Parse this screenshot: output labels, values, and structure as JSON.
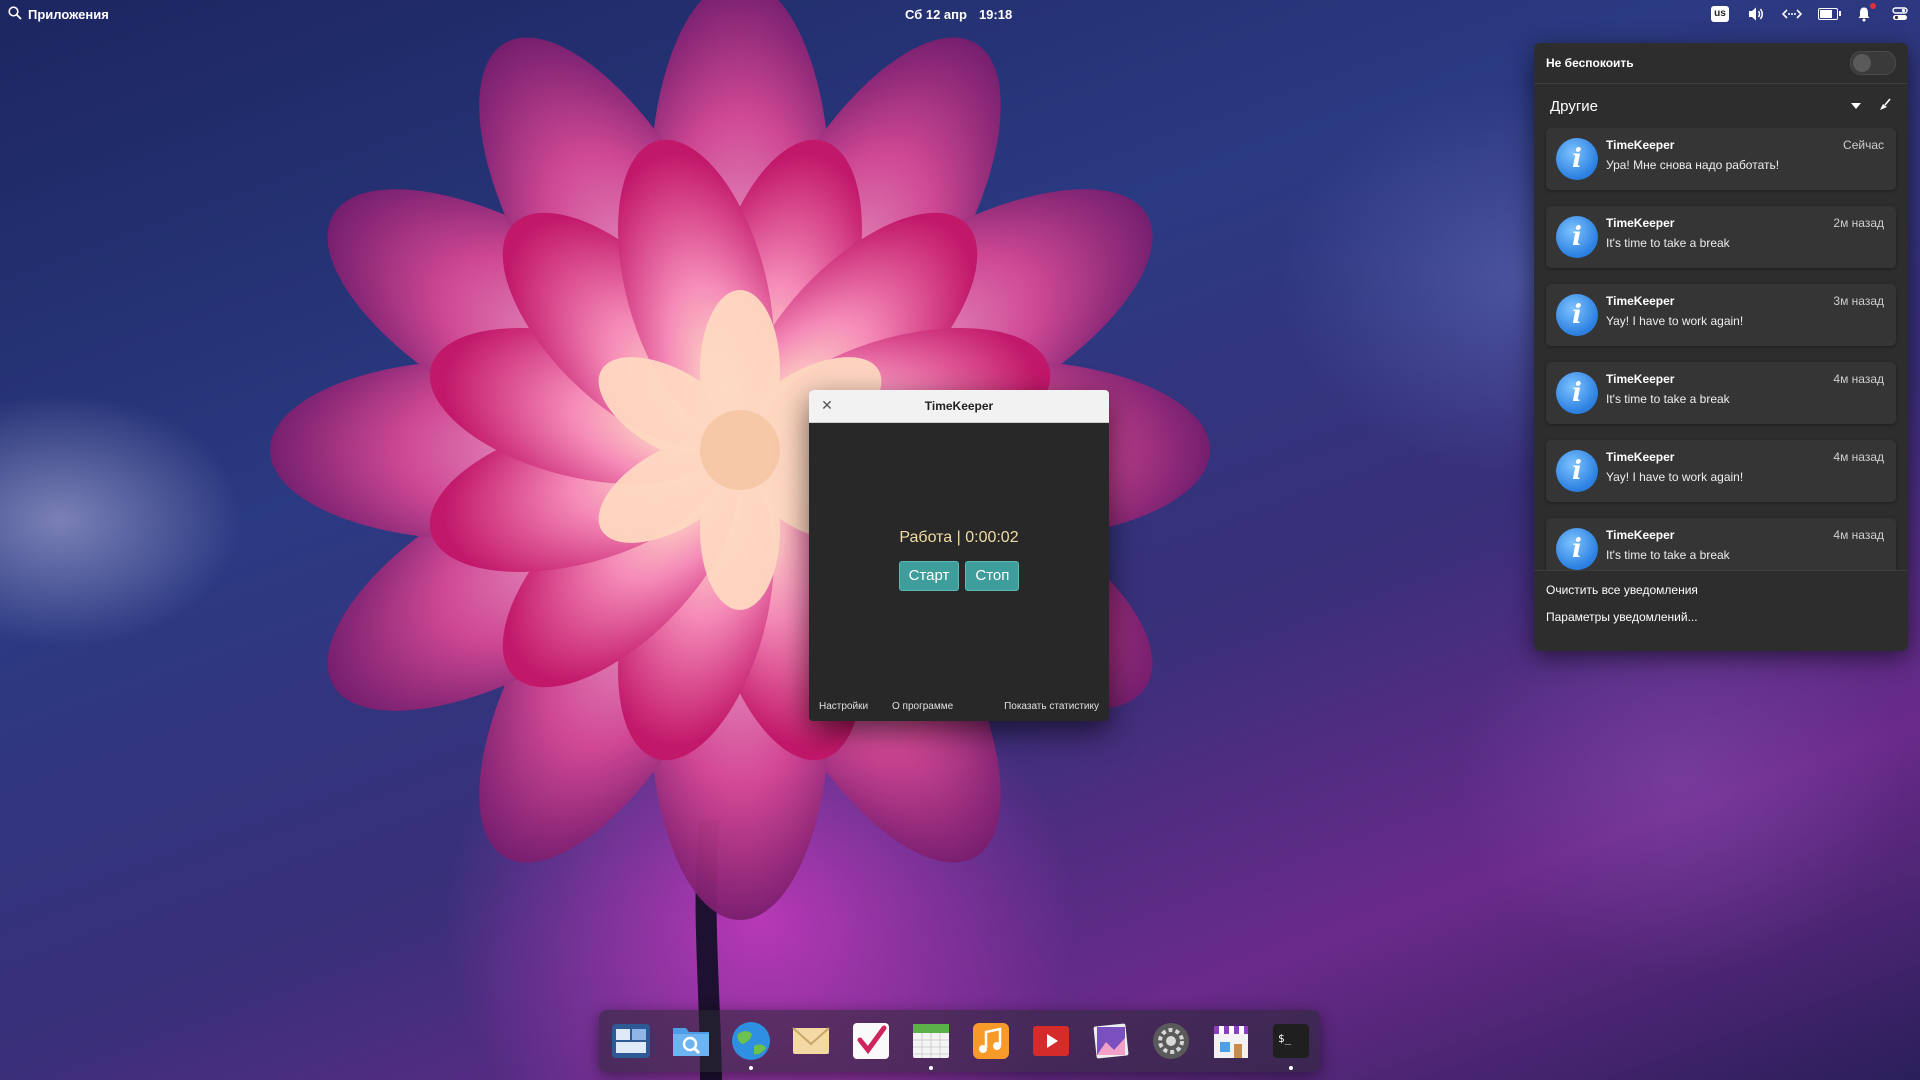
{
  "top_panel": {
    "applications_label": "Приложения",
    "date": "Сб 12 апр",
    "time": "19:18",
    "keyboard_layout": "us",
    "battery_level_percent": 70
  },
  "notification_panel": {
    "dnd_label": "Не беспокоить",
    "dnd_enabled": false,
    "group_title": "Другие",
    "notifications": [
      {
        "app": "TimeKeeper",
        "time": "Сейчас",
        "body": "Ура! Мне снова надо работать!"
      },
      {
        "app": "TimeKeeper",
        "time": "2м назад",
        "body": "It's time to take a break"
      },
      {
        "app": "TimeKeeper",
        "time": "3м назад",
        "body": "Yay! I have to work again!"
      },
      {
        "app": "TimeKeeper",
        "time": "4м назад",
        "body": "It's time to take a break"
      },
      {
        "app": "TimeKeeper",
        "time": "4м назад",
        "body": "Yay! I have to work again!"
      },
      {
        "app": "TimeKeeper",
        "time": "4м назад",
        "body": "It's time to take a break"
      }
    ],
    "clear_all_label": "Очистить все уведомления",
    "settings_label": "Параметры уведомлений..."
  },
  "timekeeper": {
    "window_title": "TimeKeeper",
    "status_text": "Работа | 0:00:02",
    "start_label": "Старт",
    "stop_label": "Стоп",
    "settings_link": "Настройки",
    "about_link": "О программе",
    "stats_link": "Показать статистику",
    "button_color": "#3f9e9c",
    "status_color": "#f2dca6"
  },
  "dock": {
    "items": [
      {
        "name": "multitasking-view",
        "running": false
      },
      {
        "name": "files",
        "running": false
      },
      {
        "name": "web-browser",
        "running": true
      },
      {
        "name": "mail",
        "running": false
      },
      {
        "name": "tasks",
        "running": false
      },
      {
        "name": "calendar",
        "running": true
      },
      {
        "name": "music",
        "running": false
      },
      {
        "name": "videos",
        "running": false
      },
      {
        "name": "photos",
        "running": false
      },
      {
        "name": "system-settings",
        "running": false
      },
      {
        "name": "appcenter",
        "running": false
      },
      {
        "name": "terminal",
        "running": true
      }
    ]
  }
}
